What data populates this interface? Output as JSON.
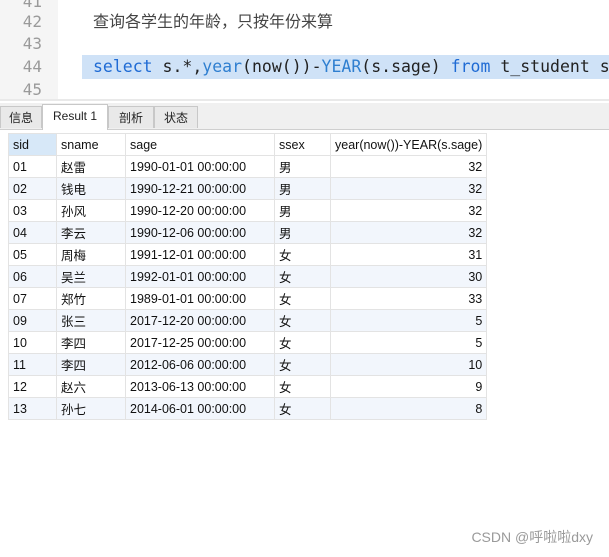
{
  "editor": {
    "line_numbers": [
      "41",
      "42",
      "43",
      "44",
      "45"
    ],
    "comment": "查询各学生的年龄，只按年份来算",
    "sql_tokens": [
      {
        "t": "select",
        "c": "kw"
      },
      {
        "t": " s.*,",
        "c": "tx"
      },
      {
        "t": "year",
        "c": "fn"
      },
      {
        "t": "(now())-",
        "c": "tx"
      },
      {
        "t": "YEAR",
        "c": "fn"
      },
      {
        "t": "(s.sage) ",
        "c": "tx"
      },
      {
        "t": "from",
        "c": "kw"
      },
      {
        "t": " t_student s",
        "c": "tx"
      }
    ]
  },
  "tabs": [
    "信息",
    "Result 1",
    "剖析",
    "状态"
  ],
  "active_tab": 1,
  "table": {
    "columns": [
      "sid",
      "sname",
      "sage",
      "ssex",
      "year(now())-YEAR(s.sage)"
    ],
    "rows": [
      [
        "01",
        "赵雷",
        "1990-01-01 00:00:00",
        "男",
        "32"
      ],
      [
        "02",
        "钱电",
        "1990-12-21 00:00:00",
        "男",
        "32"
      ],
      [
        "03",
        "孙风",
        "1990-12-20 00:00:00",
        "男",
        "32"
      ],
      [
        "04",
        "李云",
        "1990-12-06 00:00:00",
        "男",
        "32"
      ],
      [
        "05",
        "周梅",
        "1991-12-01 00:00:00",
        "女",
        "31"
      ],
      [
        "06",
        "吴兰",
        "1992-01-01 00:00:00",
        "女",
        "30"
      ],
      [
        "07",
        "郑竹",
        "1989-01-01 00:00:00",
        "女",
        "33"
      ],
      [
        "09",
        "张三",
        "2017-12-20 00:00:00",
        "女",
        "5"
      ],
      [
        "10",
        "李四",
        "2017-12-25 00:00:00",
        "女",
        "5"
      ],
      [
        "11",
        "李四",
        "2012-06-06 00:00:00",
        "女",
        "10"
      ],
      [
        "12",
        "赵六",
        "2013-06-13 00:00:00",
        "女",
        "9"
      ],
      [
        "13",
        "孙七",
        "2014-06-01 00:00:00",
        "女",
        "8"
      ]
    ]
  },
  "watermark": "CSDN @呼啦啦dxy",
  "colors": {
    "keyword": "#1f6bd4",
    "selection": "#cfe2f7",
    "header_active": "#d7e8f8"
  }
}
